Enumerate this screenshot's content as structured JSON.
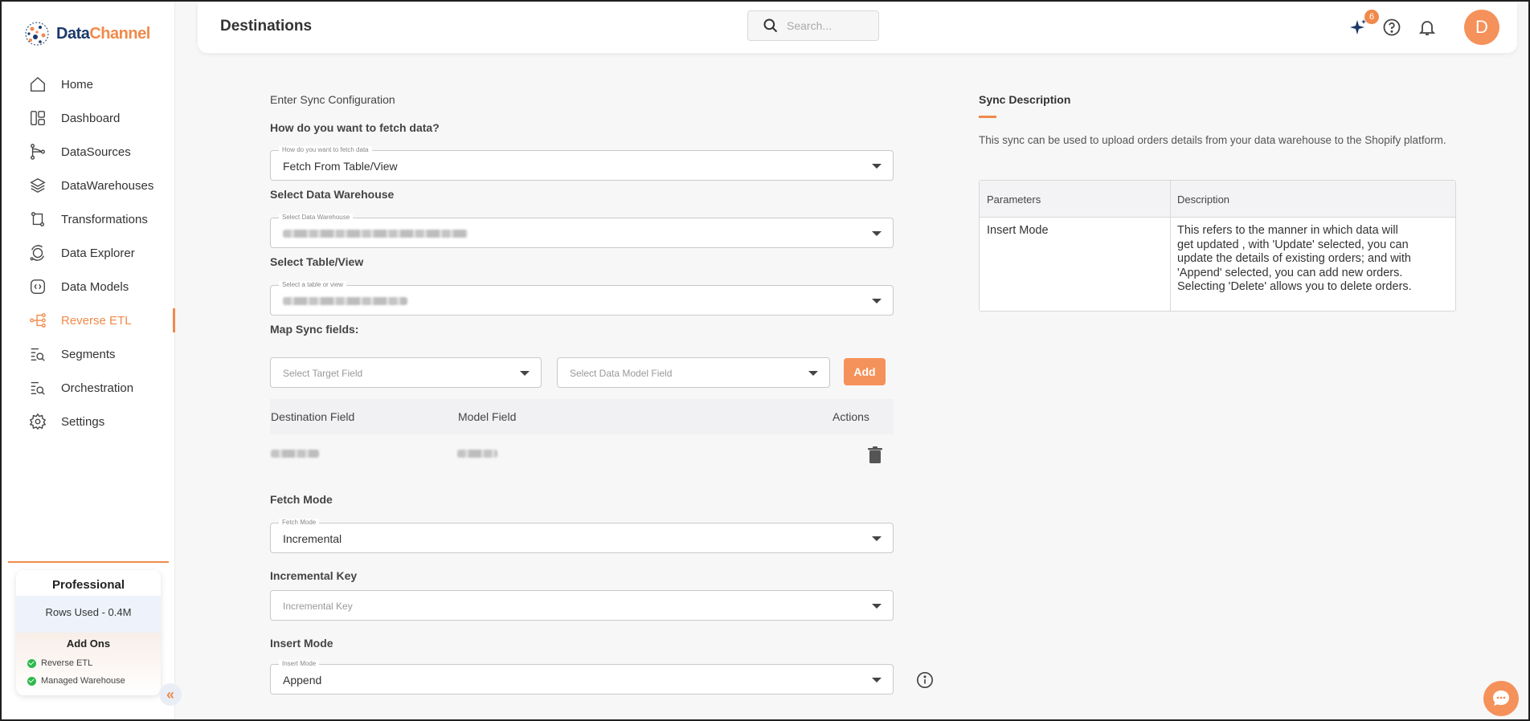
{
  "brand": {
    "name_part1": "Data",
    "name_part2": "Channel"
  },
  "sidebar": {
    "items": [
      {
        "label": "Home",
        "icon": "home-icon"
      },
      {
        "label": "Dashboard",
        "icon": "dashboard-icon"
      },
      {
        "label": "DataSources",
        "icon": "datasources-icon"
      },
      {
        "label": "DataWarehouses",
        "icon": "layers-icon"
      },
      {
        "label": "Transformations",
        "icon": "transform-icon"
      },
      {
        "label": "Data Explorer",
        "icon": "explorer-icon"
      },
      {
        "label": "Data Models",
        "icon": "models-icon"
      },
      {
        "label": "Reverse ETL",
        "icon": "reverse-etl-icon",
        "active": true
      },
      {
        "label": "Segments",
        "icon": "segments-icon"
      },
      {
        "label": "Orchestration",
        "icon": "orchestration-icon"
      },
      {
        "label": "Settings",
        "icon": "gear-icon"
      }
    ],
    "plan": {
      "title": "Professional",
      "rows_used": "Rows Used - 0.4M",
      "addons_title": "Add Ons",
      "addons": [
        "Reverse ETL",
        "Managed Warehouse"
      ]
    }
  },
  "header": {
    "title": "Destinations",
    "search_placeholder": "Search...",
    "notification_badge": "6",
    "avatar_letter": "D"
  },
  "form": {
    "section_title": "Enter Sync Configuration",
    "fetch_question": "How do you want to fetch data?",
    "fetch_legend": "How do you want to fetch data",
    "fetch_value": "Fetch From Table/View",
    "warehouse_label": "Select Data Warehouse",
    "warehouse_legend": "Select Data Warehouse",
    "table_label": "Select Table/View",
    "table_legend": "Select a table or view",
    "map_label": "Map Sync fields:",
    "target_field_placeholder": "Select Target Field",
    "model_field_placeholder": "Select Data Model Field",
    "add_button": "Add",
    "mapping_columns": [
      "Destination Field",
      "Model Field",
      "Actions"
    ],
    "fetch_mode_label": "Fetch Mode",
    "fetch_mode_legend": "Fetch Mode",
    "fetch_mode_value": "Incremental",
    "incremental_key_label": "Incremental Key",
    "incremental_key_placeholder": "Incremental Key",
    "insert_mode_label": "Insert Mode",
    "insert_mode_legend": "Insert Mode",
    "insert_mode_value": "Append"
  },
  "description": {
    "title": "Sync Description",
    "text": "This sync can be used to upload orders details from your data warehouse to the Shopify platform.",
    "table_headers": [
      "Parameters",
      "Description"
    ],
    "rows": [
      {
        "parameter": "Insert Mode",
        "lines": [
          "This refers to the manner in which data will",
          "get updated , with 'Update' selected, you can",
          "update the details of existing orders; and with",
          "'Append' selected, you can add new orders.",
          "Selecting 'Delete' allows you to delete orders."
        ]
      }
    ]
  },
  "colors": {
    "accent": "#f08a4b",
    "brand_dark": "#1c3a6b",
    "success": "#2eb84b"
  }
}
